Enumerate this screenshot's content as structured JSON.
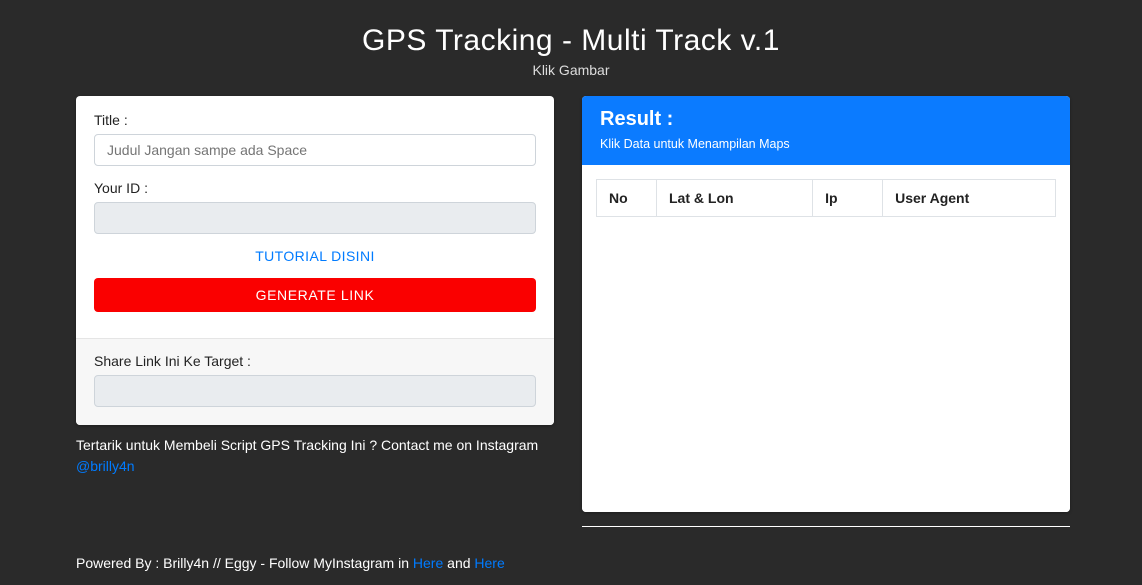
{
  "header": {
    "title": "GPS Tracking - Multi Track v.1",
    "subtitle": "Klik Gambar"
  },
  "form": {
    "title_label": "Title :",
    "title_placeholder": "Judul Jangan sampe ada Space",
    "title_value": "",
    "id_label": "Your ID :",
    "id_value": "",
    "tutorial_label": "TUTORIAL DISINI",
    "generate_label": "GENERATE LINK",
    "share_label": "Share Link Ini Ke Target :",
    "share_value": ""
  },
  "below": {
    "text": "Tertarik untuk Membeli Script GPS Tracking Ini ? Contact me on Instagram ",
    "handle": "@brilly4n"
  },
  "result": {
    "title": "Result :",
    "hint": "Klik Data untuk Menampilan Maps",
    "columns": {
      "no": "No",
      "latlon": "Lat & Lon",
      "ip": "Ip",
      "ua": "User Agent"
    },
    "rows": []
  },
  "footer": {
    "prefix": "Powered By : Brilly4n // Eggy - Follow MyInstagram in ",
    "link1": "Here",
    "mid": " and ",
    "link2": "Here"
  }
}
